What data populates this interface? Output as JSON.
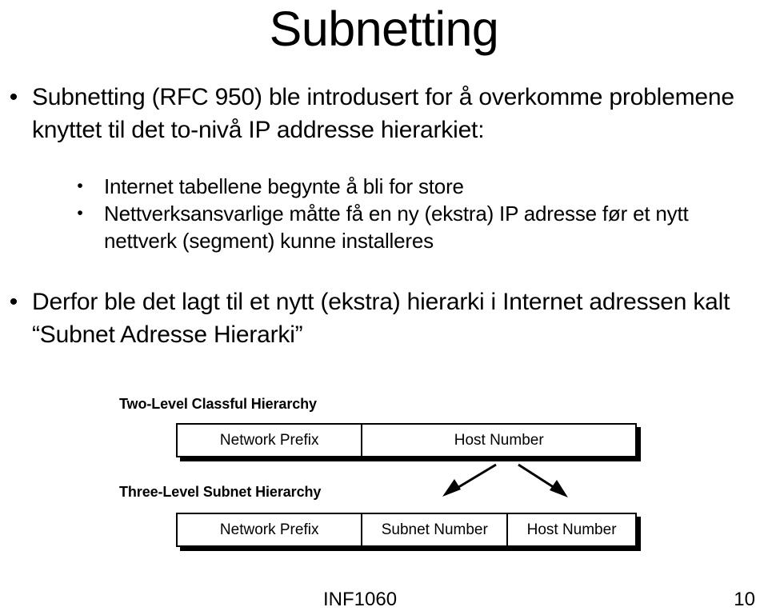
{
  "slide": {
    "title": "Subnetting",
    "bullet_marker": "•",
    "bullets": [
      {
        "level": 1,
        "text": "Subnetting (RFC 950) ble introdusert for å overkomme problemene knyttet til det to-nivå IP addresse hierarkiet:"
      },
      {
        "level": 2,
        "text": "Internet tabellene begynte å bli for store"
      },
      {
        "level": 2,
        "text": "Nettverksansvarlige måtte få en ny (ekstra) IP adresse før et nytt nettverk (segment) kunne installeres"
      },
      {
        "level": 1,
        "text": "Derfor ble det lagt til et nytt (ekstra) hierarki i Internet adressen kalt “Subnet Adresse Hierarki”"
      }
    ]
  },
  "diagram": {
    "two_level": {
      "heading": "Two-Level Classful Hierarchy",
      "cells": [
        {
          "label": "Network Prefix"
        },
        {
          "label": "Host Number"
        }
      ]
    },
    "three_level": {
      "heading": "Three-Level Subnet Hierarchy",
      "cells": [
        {
          "label": "Network Prefix"
        },
        {
          "label": "Subnet Number"
        },
        {
          "label": "Host Number"
        }
      ]
    },
    "arrows": [
      {
        "name": "arrow-split-left",
        "direction": "down-left"
      },
      {
        "name": "arrow-split-right",
        "direction": "down-right"
      }
    ],
    "line_color": "#000000",
    "fill_color": "#ffffff"
  },
  "footer": {
    "course": "INF1060",
    "page_number": "10"
  }
}
